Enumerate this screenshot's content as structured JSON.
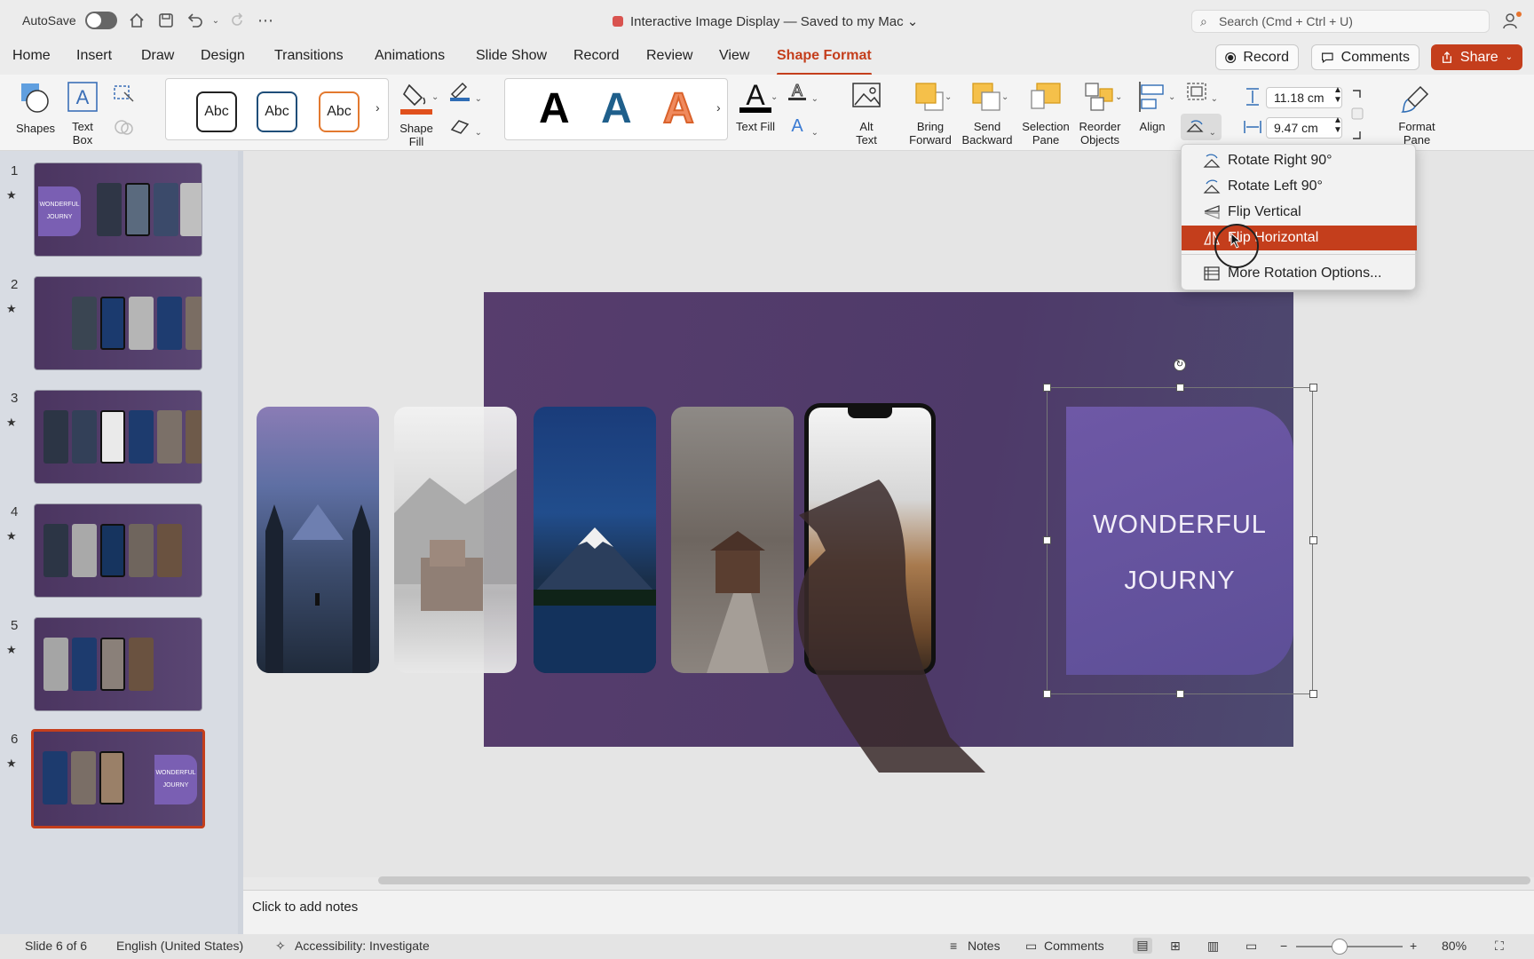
{
  "titlebar": {
    "autosave_label": "AutoSave",
    "document_title": "Interactive Image Display — Saved to my Mac ⌄",
    "search_placeholder": "Search (Cmd + Ctrl + U)"
  },
  "tabs": [
    "Home",
    "Insert",
    "Draw",
    "Design",
    "Transitions",
    "Animations",
    "Slide Show",
    "Record",
    "Review",
    "View",
    "Shape Format"
  ],
  "active_tab": "Shape Format",
  "top_right": {
    "record_label": "Record",
    "comments_label": "Comments",
    "share_label": "Share"
  },
  "ribbon": {
    "shapes_label": "Shapes",
    "text_box_label": "Text\nBox",
    "shape_style_sample": "Abc",
    "shape_fill_label": "Shape\nFill",
    "wordart_sample": "A",
    "text_fill_label": "Text Fill",
    "alt_text_label": "Alt\nText",
    "bring_forward_label": "Bring\nForward",
    "send_backward_label": "Send\nBackward",
    "selection_pane_label": "Selection\nPane",
    "reorder_objects_label": "Reorder\nObjects",
    "align_label": "Align",
    "height_value": "11.18 cm",
    "width_value": "9.47 cm",
    "format_pane_label": "Format\nPane"
  },
  "rotate_menu": {
    "items": [
      "Rotate Right 90°",
      "Rotate Left 90°",
      "Flip Vertical",
      "Flip Horizontal",
      "More Rotation Options..."
    ],
    "highlighted": "Flip Horizontal"
  },
  "thumbnails": {
    "numbers": [
      "1",
      "2",
      "3",
      "4",
      "5",
      "6"
    ],
    "star": "★",
    "thumb_text_1": "WONDERFUL\nJOURNY",
    "selected": "6"
  },
  "slide": {
    "textbox_line1": "WONDERFUL",
    "textbox_line2": "JOURNY"
  },
  "notes_placeholder": "Click to add notes",
  "status": {
    "slide_info": "Slide 6 of 6",
    "language": "English (United States)",
    "accessibility": "Accessibility: Investigate",
    "notes_label": "Notes",
    "comments_label": "Comments",
    "zoom": "80%"
  },
  "colors": {
    "accent": "#c43e1c",
    "slide_bg": "#523b69",
    "textbox_fill": "#6a55a3"
  }
}
